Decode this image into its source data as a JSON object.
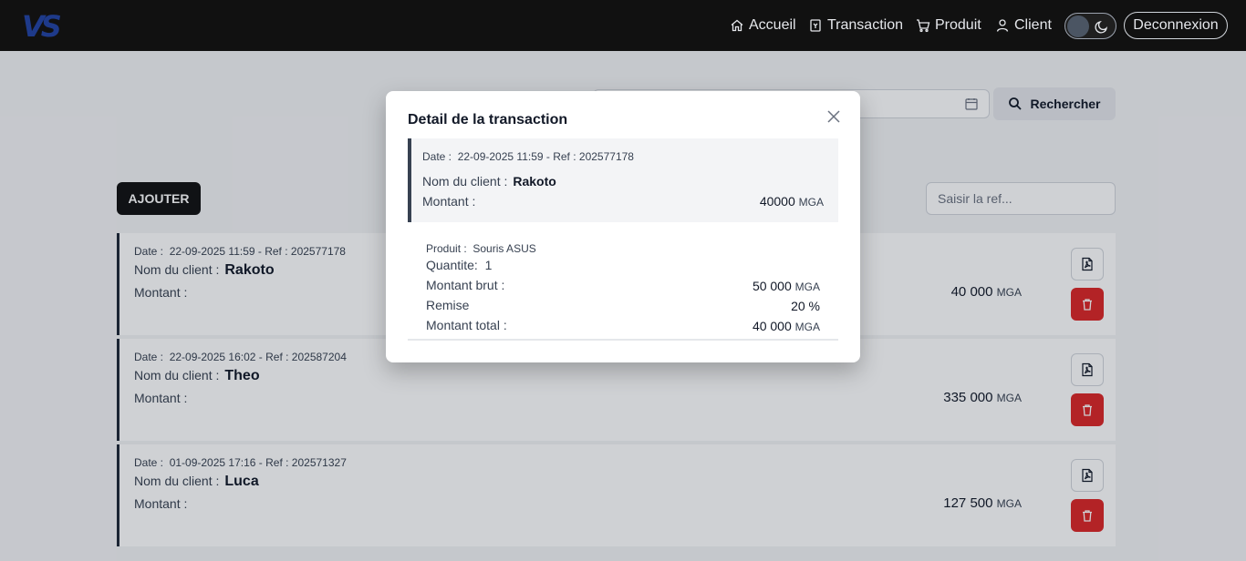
{
  "nav": {
    "logo": "VS",
    "items": [
      "Accueil",
      "Transaction",
      "Produit",
      "Client"
    ],
    "logout": "Deconnexion"
  },
  "toolbar": {
    "search_label": "Rechercher",
    "add_label": "AJOUTER",
    "ref_placeholder": "Saisir la ref..."
  },
  "labels": {
    "date": "Date :",
    "ref": "- Ref :",
    "client": "Nom du client :",
    "montant": "Montant :",
    "currency": "MGA"
  },
  "transactions": [
    {
      "date": "22-09-2025 11:59",
      "ref": "202577178",
      "client": "Rakoto",
      "amount": "40 000"
    },
    {
      "date": "22-09-2025 16:02",
      "ref": "202587204",
      "client": "Theo",
      "amount": "335 000"
    },
    {
      "date": "01-09-2025 17:16",
      "ref": "202571327",
      "client": "Luca",
      "amount": "127 500"
    }
  ],
  "modal": {
    "title": "Detail de la transaction",
    "date": "22-09-2025 11:59",
    "ref": "202577178",
    "client": "Rakoto",
    "montant": "40000",
    "produit_label": "Produit :",
    "produit": "Souris ASUS",
    "quantite_label": "Quantite:",
    "quantite": "1",
    "brut_label": "Montant brut :",
    "brut": "50 000",
    "remise_label": "Remise",
    "remise": "20 %",
    "total_label": "Montant total :",
    "total": "40 000"
  }
}
